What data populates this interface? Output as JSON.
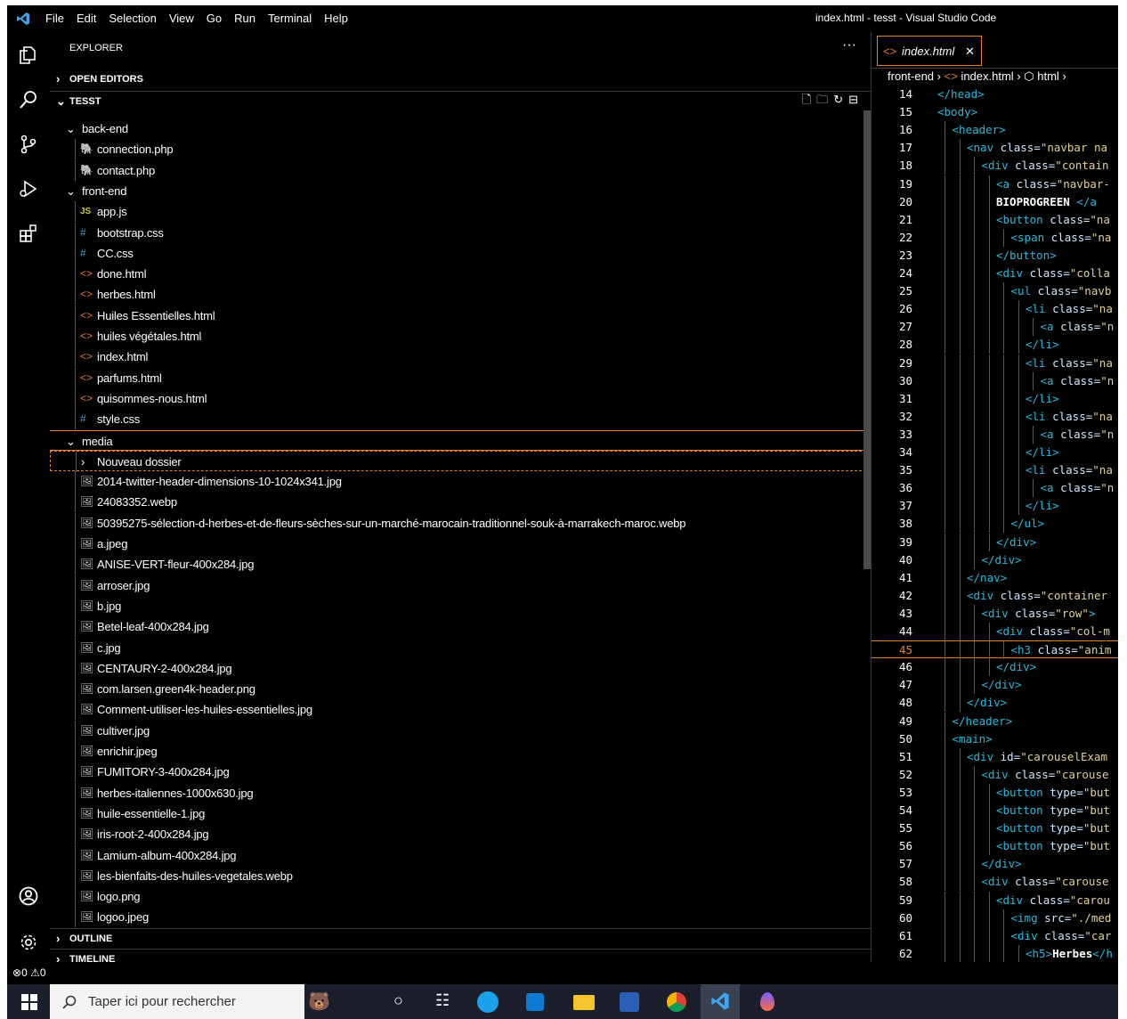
{
  "window_title": "index.html - tesst - Visual Studio Code",
  "menu": [
    "File",
    "Edit",
    "Selection",
    "View",
    "Go",
    "Run",
    "Terminal",
    "Help"
  ],
  "explorer": {
    "title": "EXPLORER",
    "more": "···",
    "sections": {
      "open_editors": "OPEN EDITORS",
      "workspace": "TESST",
      "outline": "OUTLINE",
      "timeline": "TIMELINE"
    },
    "tree": [
      {
        "name": "back-end",
        "kind": "folder",
        "depth": 1,
        "open": true
      },
      {
        "name": "connection.php",
        "kind": "php",
        "depth": 2
      },
      {
        "name": "contact.php",
        "kind": "php",
        "depth": 2
      },
      {
        "name": "front-end",
        "kind": "folder",
        "depth": 1,
        "open": true
      },
      {
        "name": "app.js",
        "kind": "js",
        "depth": 2
      },
      {
        "name": "bootstrap.css",
        "kind": "css",
        "depth": 2
      },
      {
        "name": "CC.css",
        "kind": "css",
        "depth": 2
      },
      {
        "name": "done.html",
        "kind": "html",
        "depth": 2
      },
      {
        "name": "herbes.html",
        "kind": "html",
        "depth": 2
      },
      {
        "name": "Huiles Essentielles.html",
        "kind": "html",
        "depth": 2
      },
      {
        "name": "huiles végétales.html",
        "kind": "html",
        "depth": 2
      },
      {
        "name": "index.html",
        "kind": "html",
        "depth": 2
      },
      {
        "name": "parfums.html",
        "kind": "html",
        "depth": 2
      },
      {
        "name": "quisommes-nous.html",
        "kind": "html",
        "depth": 2
      },
      {
        "name": "style.css",
        "kind": "css",
        "depth": 2
      },
      {
        "name": "media",
        "kind": "folder",
        "depth": 1,
        "open": true,
        "focused": true
      },
      {
        "name": "Nouveau dossier",
        "kind": "folder",
        "depth": 2,
        "open": false,
        "dashed": true
      },
      {
        "name": "2014-twitter-header-dimensions-10-1024x341.jpg",
        "kind": "image",
        "depth": 2
      },
      {
        "name": "24083352.webp",
        "kind": "image",
        "depth": 2
      },
      {
        "name": "50395275-sélection-d-herbes-et-de-fleurs-sèches-sur-un-marché-marocain-traditionnel-souk-à-marrakech-maroc.webp",
        "kind": "image",
        "depth": 2
      },
      {
        "name": "a.jpeg",
        "kind": "image",
        "depth": 2
      },
      {
        "name": "ANISE-VERT-fleur-400x284.jpg",
        "kind": "image",
        "depth": 2
      },
      {
        "name": "arroser.jpg",
        "kind": "image",
        "depth": 2
      },
      {
        "name": "b.jpg",
        "kind": "image",
        "depth": 2
      },
      {
        "name": "Betel-leaf-400x284.jpg",
        "kind": "image",
        "depth": 2
      },
      {
        "name": "c.jpg",
        "kind": "image",
        "depth": 2
      },
      {
        "name": "CENTAURY-2-400x284.jpg",
        "kind": "image",
        "depth": 2
      },
      {
        "name": "com.larsen.green4k-header.png",
        "kind": "image",
        "depth": 2
      },
      {
        "name": "Comment-utiliser-les-huiles-essentielles.jpg",
        "kind": "image",
        "depth": 2
      },
      {
        "name": "cultiver.jpg",
        "kind": "image",
        "depth": 2
      },
      {
        "name": "enrichir.jpeg",
        "kind": "image",
        "depth": 2
      },
      {
        "name": "FUMITORY-3-400x284.jpg",
        "kind": "image",
        "depth": 2
      },
      {
        "name": "herbes-italiennes-1000x630.jpg",
        "kind": "image",
        "depth": 2
      },
      {
        "name": "huile-essentielle-1.jpg",
        "kind": "image",
        "depth": 2
      },
      {
        "name": "iris-root-2-400x284.jpg",
        "kind": "image",
        "depth": 2
      },
      {
        "name": "Lamium-album-400x284.jpg",
        "kind": "image",
        "depth": 2
      },
      {
        "name": "les-bienfaits-des-huiles-vegetales.webp",
        "kind": "image",
        "depth": 2
      },
      {
        "name": "logo.png",
        "kind": "image",
        "depth": 2
      },
      {
        "name": "logoo.jpeg",
        "kind": "image",
        "depth": 2
      }
    ]
  },
  "editor": {
    "tab": "index.html",
    "tab_close": "✕",
    "breadcrumb": [
      "front-end",
      "index.html",
      "html"
    ],
    "active_line": 45,
    "lines": [
      {
        "n": "14",
        "d": 0,
        "p": [
          [
            "tag",
            "</head>"
          ]
        ]
      },
      {
        "n": "15",
        "d": 0,
        "p": [
          [
            "tag",
            "<body>"
          ]
        ]
      },
      {
        "n": "16",
        "d": 1,
        "p": [
          [
            "tag",
            "<header>"
          ]
        ]
      },
      {
        "n": "17",
        "d": 2,
        "p": [
          [
            "tag",
            "<nav "
          ],
          [
            "attr",
            "class="
          ],
          [
            "str",
            "\"navbar na"
          ]
        ]
      },
      {
        "n": "18",
        "d": 3,
        "p": [
          [
            "tag",
            "<div "
          ],
          [
            "attr",
            "class="
          ],
          [
            "str",
            "\"contain"
          ]
        ]
      },
      {
        "n": "19",
        "d": 4,
        "p": [
          [
            "tag",
            "<a "
          ],
          [
            "attr",
            "class="
          ],
          [
            "str",
            "\"navbar-"
          ]
        ]
      },
      {
        "n": "20",
        "d": 4,
        "p": [
          [
            "txt",
            "BIOPROGREEN "
          ],
          [
            "tag",
            "</a"
          ]
        ]
      },
      {
        "n": "21",
        "d": 4,
        "p": [
          [
            "tag",
            "<button "
          ],
          [
            "attr",
            "class="
          ],
          [
            "str",
            "\"na"
          ]
        ]
      },
      {
        "n": "22",
        "d": 5,
        "p": [
          [
            "tag",
            "<span "
          ],
          [
            "attr",
            "class="
          ],
          [
            "str",
            "\"na"
          ]
        ]
      },
      {
        "n": "23",
        "d": 4,
        "p": [
          [
            "tag",
            "</button>"
          ]
        ]
      },
      {
        "n": "24",
        "d": 4,
        "p": [
          [
            "tag",
            "<div "
          ],
          [
            "attr",
            "class="
          ],
          [
            "str",
            "\"colla"
          ]
        ]
      },
      {
        "n": "25",
        "d": 5,
        "p": [
          [
            "tag",
            "<ul "
          ],
          [
            "attr",
            "class="
          ],
          [
            "str",
            "\"navb"
          ]
        ]
      },
      {
        "n": "26",
        "d": 6,
        "p": [
          [
            "tag",
            "<li "
          ],
          [
            "attr",
            "class="
          ],
          [
            "str",
            "\"na"
          ]
        ]
      },
      {
        "n": "27",
        "d": 7,
        "p": [
          [
            "tag",
            "<a "
          ],
          [
            "attr",
            "class="
          ],
          [
            "str",
            "\"n"
          ]
        ]
      },
      {
        "n": "28",
        "d": 6,
        "p": [
          [
            "tag",
            "</li>"
          ]
        ]
      },
      {
        "n": "29",
        "d": 6,
        "p": [
          [
            "tag",
            "<li "
          ],
          [
            "attr",
            "class="
          ],
          [
            "str",
            "\"na"
          ]
        ]
      },
      {
        "n": "30",
        "d": 7,
        "p": [
          [
            "tag",
            "<a "
          ],
          [
            "attr",
            "class="
          ],
          [
            "str",
            "\"n"
          ]
        ]
      },
      {
        "n": "31",
        "d": 6,
        "p": [
          [
            "tag",
            "</li>"
          ]
        ]
      },
      {
        "n": "32",
        "d": 6,
        "p": [
          [
            "tag",
            "<li "
          ],
          [
            "attr",
            "class="
          ],
          [
            "str",
            "\"na"
          ]
        ]
      },
      {
        "n": "33",
        "d": 7,
        "p": [
          [
            "tag",
            "<a "
          ],
          [
            "attr",
            "class="
          ],
          [
            "str",
            "\"n"
          ]
        ]
      },
      {
        "n": "34",
        "d": 6,
        "p": [
          [
            "tag",
            "</li>"
          ]
        ]
      },
      {
        "n": "35",
        "d": 6,
        "p": [
          [
            "tag",
            "<li "
          ],
          [
            "attr",
            "class="
          ],
          [
            "str",
            "\"na"
          ]
        ]
      },
      {
        "n": "36",
        "d": 7,
        "p": [
          [
            "tag",
            "<a "
          ],
          [
            "attr",
            "class="
          ],
          [
            "str",
            "\"n"
          ]
        ]
      },
      {
        "n": "37",
        "d": 6,
        "p": [
          [
            "tag",
            "</li>"
          ]
        ]
      },
      {
        "n": "38",
        "d": 5,
        "p": [
          [
            "tag",
            "</ul>"
          ]
        ]
      },
      {
        "n": "39",
        "d": 4,
        "p": [
          [
            "tag",
            "</div>"
          ]
        ]
      },
      {
        "n": "40",
        "d": 3,
        "p": [
          [
            "tag",
            "</div>"
          ]
        ]
      },
      {
        "n": "41",
        "d": 2,
        "p": [
          [
            "tag",
            "</nav>"
          ]
        ]
      },
      {
        "n": "42",
        "d": 2,
        "p": [
          [
            "tag",
            "<div "
          ],
          [
            "attr",
            "class="
          ],
          [
            "str",
            "\"container"
          ]
        ]
      },
      {
        "n": "43",
        "d": 3,
        "p": [
          [
            "tag",
            "<div "
          ],
          [
            "attr",
            "class="
          ],
          [
            "str",
            "\"row\""
          ],
          [
            "tag",
            ">"
          ]
        ]
      },
      {
        "n": "44",
        "d": 4,
        "p": [
          [
            "tag",
            "<div "
          ],
          [
            "attr",
            "class="
          ],
          [
            "str",
            "\"col-m"
          ]
        ]
      },
      {
        "n": "45",
        "d": 5,
        "p": [
          [
            "tag",
            "<h3 "
          ],
          [
            "attr",
            "class="
          ],
          [
            "str",
            "\"anim"
          ]
        ]
      },
      {
        "n": "46",
        "d": 4,
        "p": [
          [
            "tag",
            "</div>"
          ]
        ]
      },
      {
        "n": "47",
        "d": 3,
        "p": [
          [
            "tag",
            "</div>"
          ]
        ]
      },
      {
        "n": "48",
        "d": 2,
        "p": [
          [
            "tag",
            "</div>"
          ]
        ]
      },
      {
        "n": "49",
        "d": 1,
        "p": [
          [
            "tag",
            "</header>"
          ]
        ]
      },
      {
        "n": "50",
        "d": 1,
        "p": [
          [
            "tag",
            "<main>"
          ]
        ]
      },
      {
        "n": "51",
        "d": 2,
        "p": [
          [
            "tag",
            "<div "
          ],
          [
            "attr",
            "id="
          ],
          [
            "str",
            "\"carouselExam"
          ]
        ]
      },
      {
        "n": "52",
        "d": 3,
        "p": [
          [
            "tag",
            "<div "
          ],
          [
            "attr",
            "class="
          ],
          [
            "str",
            "\"carouse"
          ]
        ]
      },
      {
        "n": "53",
        "d": 4,
        "p": [
          [
            "tag",
            "<button "
          ],
          [
            "attr",
            "type="
          ],
          [
            "str",
            "\"but"
          ]
        ]
      },
      {
        "n": "54",
        "d": 4,
        "p": [
          [
            "tag",
            "<button "
          ],
          [
            "attr",
            "type="
          ],
          [
            "str",
            "\"but"
          ]
        ]
      },
      {
        "n": "55",
        "d": 4,
        "p": [
          [
            "tag",
            "<button "
          ],
          [
            "attr",
            "type="
          ],
          [
            "str",
            "\"but"
          ]
        ]
      },
      {
        "n": "56",
        "d": 4,
        "p": [
          [
            "tag",
            "<button "
          ],
          [
            "attr",
            "type="
          ],
          [
            "str",
            "\"but"
          ]
        ]
      },
      {
        "n": "57",
        "d": 3,
        "p": [
          [
            "tag",
            "</div>"
          ]
        ]
      },
      {
        "n": "58",
        "d": 3,
        "p": [
          [
            "tag",
            "<div "
          ],
          [
            "attr",
            "class="
          ],
          [
            "str",
            "\"carouse"
          ]
        ]
      },
      {
        "n": "59",
        "d": 4,
        "p": [
          [
            "tag",
            "<div "
          ],
          [
            "attr",
            "class="
          ],
          [
            "str",
            "\"carou"
          ]
        ]
      },
      {
        "n": "60",
        "d": 5,
        "p": [
          [
            "tag",
            "<img "
          ],
          [
            "attr",
            "src="
          ],
          [
            "str",
            "\"./med"
          ]
        ]
      },
      {
        "n": "61",
        "d": 5,
        "p": [
          [
            "tag",
            "<div "
          ],
          [
            "attr",
            "class="
          ],
          [
            "str",
            "\"car"
          ]
        ]
      },
      {
        "n": "62",
        "d": 6,
        "p": [
          [
            "tag",
            "<h5>"
          ],
          [
            "txt",
            "Herbes"
          ],
          [
            "tag",
            "</h"
          ]
        ]
      }
    ]
  },
  "status": {
    "errors": "0",
    "warnings": "0"
  },
  "taskbar": {
    "search_placeholder": "Taper ici pour rechercher"
  },
  "colors": {
    "accent": "#e1822a",
    "folder_guide": "#585858",
    "tag": "#29b8db",
    "string": "#e2d09a",
    "html_icon": "#e37933",
    "css_icon": "#519aba",
    "js_icon": "#cbcb41",
    "php_icon": "#a074c4"
  }
}
